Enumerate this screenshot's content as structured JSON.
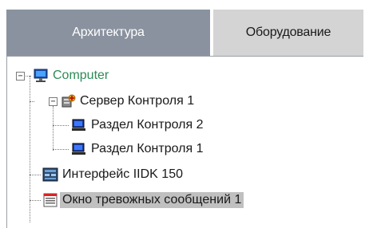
{
  "tabs": [
    {
      "label": "Архитектура",
      "active": false
    },
    {
      "label": "Оборудование",
      "active": true
    }
  ],
  "tree": {
    "root": {
      "label": "Computer",
      "icon": "computer-icon",
      "expanded": true
    },
    "server": {
      "label": "Сервер Контроля 1",
      "icon": "server-icon",
      "expanded": true
    },
    "section2": {
      "label": "Раздел  Контроля 2",
      "icon": "monitor-icon"
    },
    "section1": {
      "label": "Раздел  Контроля 1",
      "icon": "monitor-icon"
    },
    "iidk": {
      "label": "Интерфейс IIDK 150",
      "icon": "interface-icon"
    },
    "alarm": {
      "label": "Окно тревожных сообщений 1",
      "icon": "alarm-window-icon",
      "selected": true
    }
  },
  "colors": {
    "tab_inactive": "#8a929f",
    "tab_active": "#d4d4d4",
    "root_label": "#2e8b57",
    "selection": "#c0c0c0"
  }
}
